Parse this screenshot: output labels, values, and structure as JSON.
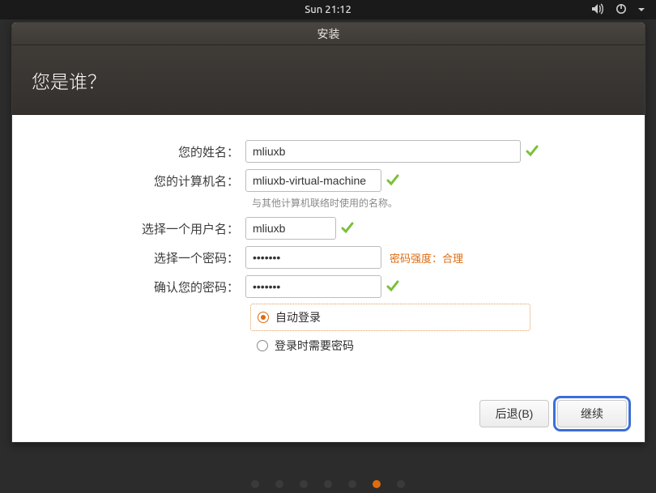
{
  "topbar": {
    "clock": "Sun 21:12"
  },
  "window": {
    "title": "安装"
  },
  "header": {
    "title": "您是谁？"
  },
  "form": {
    "name_label": "您的姓名：",
    "name_value": "mliuxb",
    "host_label": "您的计算机名：",
    "host_value": "mliuxb-virtual-machine",
    "host_hint": "与其他计算机联络时使用的名称。",
    "user_label": "选择一个用户名：",
    "user_value": "mliuxb",
    "pass_label": "选择一个密码：",
    "pass_value": "•••••••",
    "pass_strength": "密码强度：合理",
    "confirm_label": "确认您的密码：",
    "confirm_value": "•••••••",
    "auto_login_label": "自动登录",
    "require_pass_label": "登录时需要密码"
  },
  "buttons": {
    "back": "后退(B)",
    "continue": "继续"
  },
  "progress": {
    "total": 7,
    "active": 5
  }
}
